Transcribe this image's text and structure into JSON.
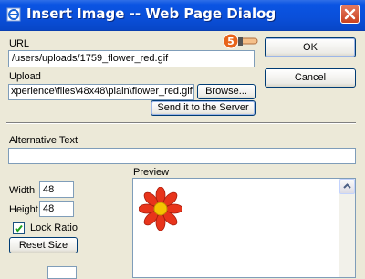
{
  "window": {
    "title": "Insert Image -- Web Page Dialog"
  },
  "url": {
    "label": "URL",
    "value": "/users/uploads/1759_flower_red.gif"
  },
  "upload": {
    "label": "Upload",
    "value": "xperience\\files\\48x48\\plain\\flower_red.gif",
    "browse_label": "Browse...",
    "send_label": "Send it to the Server"
  },
  "buttons": {
    "ok": "OK",
    "cancel": "Cancel"
  },
  "step_badge": "5",
  "alt_text": {
    "label": "Alternative Text",
    "value": ""
  },
  "size": {
    "width_label": "Width",
    "width_value": "48",
    "height_label": "Height",
    "height_value": "48",
    "lock_ratio_label": "Lock Ratio",
    "lock_ratio_checked": true,
    "reset_label": "Reset Size"
  },
  "preview": {
    "label": "Preview"
  },
  "colors": {
    "titlebar": "#0a54e3",
    "badge": "#e8641b",
    "flower": "#e8341b"
  },
  "icons": {
    "title": "ie-page-icon",
    "close": "close-icon",
    "pointer": "hand-pointer-icon",
    "flower": "flower-image"
  }
}
